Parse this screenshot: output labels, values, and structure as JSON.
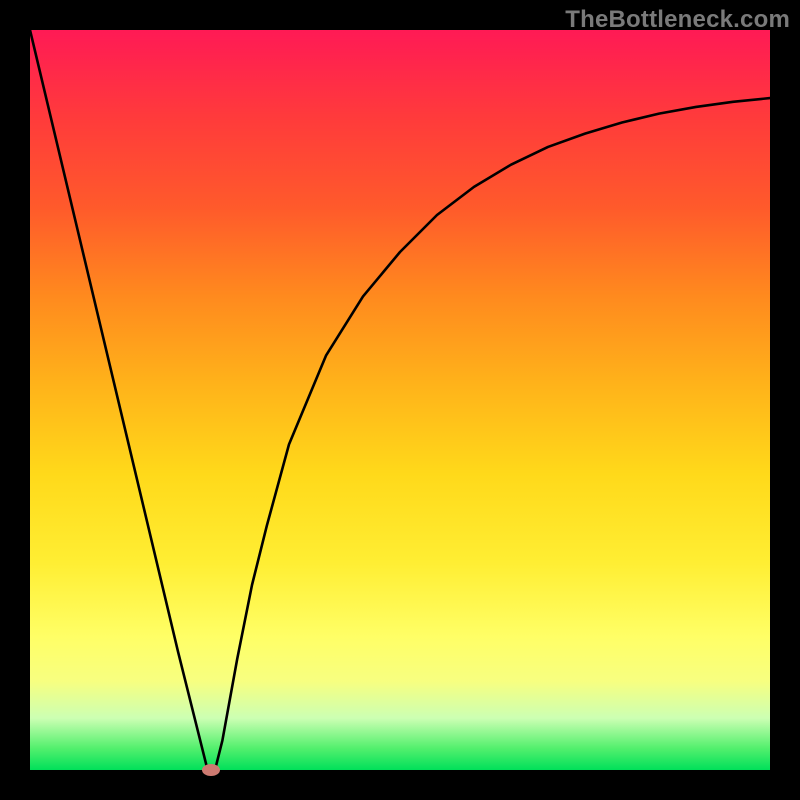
{
  "watermark": "TheBottleneck.com",
  "chart_data": {
    "type": "line",
    "title": "",
    "xlabel": "",
    "ylabel": "",
    "xlim": [
      0,
      100
    ],
    "ylim": [
      0,
      100
    ],
    "grid": false,
    "legend": false,
    "series": [
      {
        "name": "bottleneck-curve",
        "x": [
          0,
          5,
          10,
          15,
          20,
          24,
          25,
          26,
          28,
          30,
          32,
          35,
          40,
          45,
          50,
          55,
          60,
          65,
          70,
          75,
          80,
          85,
          90,
          95,
          100
        ],
        "values": [
          100,
          79,
          58,
          37,
          16,
          0,
          0,
          4,
          15,
          25,
          33,
          44,
          56,
          64,
          70,
          75,
          78.8,
          81.8,
          84.2,
          86.0,
          87.5,
          88.7,
          89.6,
          90.3,
          90.8
        ]
      }
    ],
    "marker": {
      "x": 24.5,
      "y": 0
    },
    "gradient_stops": [
      {
        "pos": 0,
        "color": "#ff1a55"
      },
      {
        "pos": 12,
        "color": "#ff3b3b"
      },
      {
        "pos": 24,
        "color": "#ff5a2b"
      },
      {
        "pos": 36,
        "color": "#ff8a1e"
      },
      {
        "pos": 48,
        "color": "#ffb31a"
      },
      {
        "pos": 60,
        "color": "#ffd91a"
      },
      {
        "pos": 72,
        "color": "#ffee33"
      },
      {
        "pos": 82,
        "color": "#ffff66"
      },
      {
        "pos": 88,
        "color": "#f7ff80"
      },
      {
        "pos": 93,
        "color": "#ccffb3"
      },
      {
        "pos": 97,
        "color": "#55f06e"
      },
      {
        "pos": 100,
        "color": "#00e05a"
      }
    ]
  }
}
